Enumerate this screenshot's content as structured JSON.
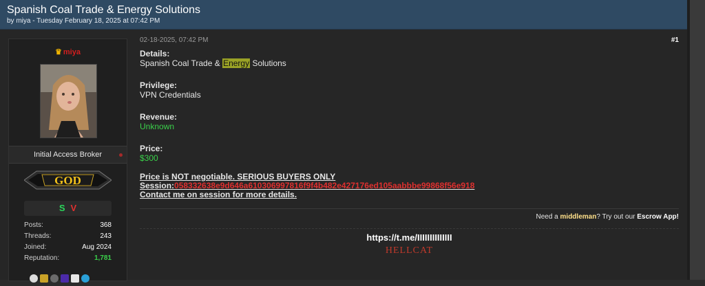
{
  "thread": {
    "title": "Spanish Coal Trade & Energy Solutions",
    "byline": "by miya - Tuesday February 18, 2025 at 07:42 PM"
  },
  "author": {
    "username": "miya",
    "role": "Initial Access Broker",
    "rank_badge": "GOD",
    "badges": [
      "S",
      "V"
    ],
    "stats": [
      {
        "label": "Posts:",
        "value": "368"
      },
      {
        "label": "Threads:",
        "value": "243"
      },
      {
        "label": "Joined:",
        "value": "Aug 2024"
      },
      {
        "label": "Reputation:",
        "value": "1,781"
      }
    ],
    "icons": [
      "lightbulb-icon",
      "trophy-icon",
      "hat-icon",
      "potion-icon",
      "flag-icon",
      "globe-icon"
    ]
  },
  "post": {
    "date": "02-18-2025, 07:42 PM",
    "number": "#1",
    "details_label": "Details:",
    "details_before": "Spanish Coal Trade & ",
    "details_highlight": "Energy",
    "details_after": " Solutions",
    "privilege_label": "Privilege:",
    "privilege_value": "VPN Credentials",
    "revenue_label": "Revenue:",
    "revenue_value": "Unknown",
    "price_label": "Price:",
    "price_value": "$300",
    "notice": "Price is NOT negotiable. SERIOUS BUYERS ONLY",
    "session_label": "Session:",
    "session_value": "058332638e9d646a610306997816f9f4b482e427176ed105aabbbe99868f56e918",
    "contact": "Contact me on session for more details."
  },
  "middleman": {
    "prefix": "Need a ",
    "middleman": "middleman",
    "mid": "? Try out our ",
    "escrow": "Escrow App!"
  },
  "signature": {
    "link": "https://t.me/IIIIIIIIIIIIII",
    "name": "HELLCAT"
  },
  "colors": {
    "header": "#2f4a63",
    "green": "#3ad04a",
    "red": "#e0302f",
    "highlight": "#9aa226"
  }
}
